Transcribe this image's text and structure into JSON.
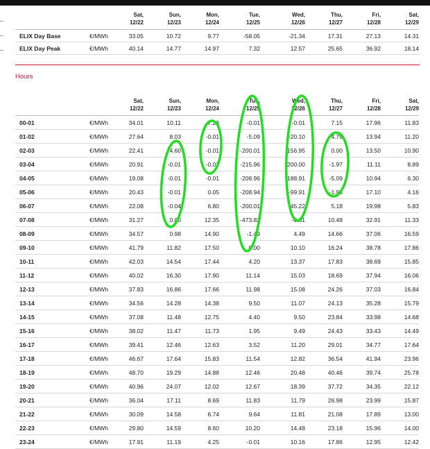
{
  "summary": {
    "days": [
      {
        "dow": "Sat,",
        "date": "12/22"
      },
      {
        "dow": "Sun,",
        "date": "12/23"
      },
      {
        "dow": "Mon,",
        "date": "12/24"
      },
      {
        "dow": "Tue,",
        "date": "12/25"
      },
      {
        "dow": "Wed,",
        "date": "12/26"
      },
      {
        "dow": "Thu,",
        "date": "12/27"
      },
      {
        "dow": "Fri,",
        "date": "12/28"
      },
      {
        "dow": "Sat,",
        "date": "12/29"
      }
    ],
    "rows": [
      {
        "label": "ELIX Day Base",
        "unit": "€/MWh",
        "values": [
          "33.05",
          "10.72",
          "9.77",
          "-58.05",
          "-21.34",
          "17.31",
          "27.13",
          "14.31"
        ]
      },
      {
        "label": "ELIX Day Peak",
        "unit": "€/MWh",
        "values": [
          "40.14",
          "14.77",
          "14.97",
          "7.32",
          "12.57",
          "25.65",
          "36.92",
          "18.14"
        ]
      }
    ]
  },
  "hours_heading": "Hours",
  "hours": {
    "days": [
      {
        "dow": "Sat,",
        "date": "12/22"
      },
      {
        "dow": "Sun,",
        "date": "12/23"
      },
      {
        "dow": "Mon,",
        "date": "12/24"
      },
      {
        "dow": "Tue,",
        "date": "12/25"
      },
      {
        "dow": "Wed,",
        "date": "12/26"
      },
      {
        "dow": "Thu,",
        "date": "12/27"
      },
      {
        "dow": "Fri,",
        "date": "12/28"
      },
      {
        "dow": "Sat,",
        "date": "12/29"
      }
    ],
    "rows": [
      {
        "label": "00-01",
        "unit": "€/MWh",
        "values": [
          "34.01",
          "10.11",
          "7.23",
          "-0.01",
          "-0.01",
          "7.15",
          "17.96",
          "11.83"
        ]
      },
      {
        "label": "01-02",
        "unit": "€/MWh",
        "values": [
          "27.64",
          "8.03",
          "-0.01",
          "-5.09",
          "-20.10",
          "4.79",
          "13.94",
          "11.20"
        ]
      },
      {
        "label": "02-03",
        "unit": "€/MWh",
        "values": [
          "22.41",
          "4.60",
          "-0.01",
          "-200.01",
          "-156.95",
          "0.00",
          "13.50",
          "10.90"
        ]
      },
      {
        "label": "03-04",
        "unit": "€/MWh",
        "values": [
          "20.91",
          "-0.01",
          "-0.07",
          "-215.96",
          "-200.00",
          "-1.97",
          "11.11",
          "8.89"
        ]
      },
      {
        "label": "04-05",
        "unit": "€/MWh",
        "values": [
          "19.08",
          "-0.01",
          "-0.01",
          "-208.96",
          "-188.91",
          "-5.09",
          "10.94",
          "6.30"
        ]
      },
      {
        "label": "05-06",
        "unit": "€/MWh",
        "values": [
          "20.43",
          "-0.01",
          "0.05",
          "-208.94",
          "-99.91",
          "-1.95",
          "17.10",
          "4.16"
        ]
      },
      {
        "label": "06-07",
        "unit": "€/MWh",
        "values": [
          "22.08",
          "-0.04",
          "6.80",
          "-200.01",
          "-45.22",
          "5.18",
          "19.98",
          "5.83"
        ]
      },
      {
        "label": "07-08",
        "unit": "€/MWh",
        "values": [
          "31.27",
          "0.00",
          "12.35",
          "-473.82",
          "-0.01",
          "10.48",
          "32.91",
          "11.33"
        ]
      },
      {
        "label": "08-09",
        "unit": "€/MWh",
        "values": [
          "34.57",
          "0.98",
          "14.90",
          "-1.49",
          "4.49",
          "14.66",
          "37.06",
          "16.59"
        ]
      },
      {
        "label": "09-10",
        "unit": "€/MWh",
        "values": [
          "41.79",
          "11.82",
          "17.50",
          "0.00",
          "10.10",
          "16.24",
          "38.78",
          "17.86"
        ]
      },
      {
        "label": "10-11",
        "unit": "€/MWh",
        "values": [
          "42.03",
          "14.54",
          "17.44",
          "4.20",
          "13.37",
          "17.83",
          "38.69",
          "15.85"
        ]
      },
      {
        "label": "11-12",
        "unit": "€/MWh",
        "values": [
          "40.02",
          "16.30",
          "17.90",
          "11.14",
          "15.03",
          "18.69",
          "37.94",
          "16.06"
        ]
      },
      {
        "label": "12-13",
        "unit": "€/MWh",
        "values": [
          "37.83",
          "16.86",
          "17.66",
          "11.98",
          "15.08",
          "24.26",
          "37.03",
          "16.84"
        ]
      },
      {
        "label": "13-14",
        "unit": "€/MWh",
        "values": [
          "34.56",
          "14.28",
          "14.38",
          "9.50",
          "11.07",
          "24.13",
          "35.28",
          "15.79"
        ]
      },
      {
        "label": "14-15",
        "unit": "€/MWh",
        "values": [
          "37.08",
          "11.48",
          "12.75",
          "4.40",
          "9.50",
          "23.84",
          "33.98",
          "14.68"
        ]
      },
      {
        "label": "15-16",
        "unit": "€/MWh",
        "values": [
          "38.02",
          "11.47",
          "11.73",
          "1.95",
          "9.49",
          "24.43",
          "33.43",
          "14.49"
        ]
      },
      {
        "label": "16-17",
        "unit": "€/MWh",
        "values": [
          "39.41",
          "12.46",
          "12.63",
          "3.52",
          "11.20",
          "29.01",
          "34.77",
          "17.64"
        ]
      },
      {
        "label": "17-18",
        "unit": "€/MWh",
        "values": [
          "46.67",
          "17.64",
          "15.83",
          "11.54",
          "12.82",
          "36.54",
          "41.94",
          "23.96"
        ]
      },
      {
        "label": "18-19",
        "unit": "€/MWh",
        "values": [
          "48.70",
          "19.29",
          "14.88",
          "12.46",
          "20.48",
          "40.46",
          "39.74",
          "25.78"
        ]
      },
      {
        "label": "19-20",
        "unit": "€/MWh",
        "values": [
          "40.96",
          "24.07",
          "12.02",
          "12.67",
          "18.39",
          "37.72",
          "34.35",
          "22.12"
        ]
      },
      {
        "label": "20-21",
        "unit": "€/MWh",
        "values": [
          "36.04",
          "17.11",
          "8.69",
          "11.83",
          "11.79",
          "26.98",
          "23.99",
          "15.87"
        ]
      },
      {
        "label": "21-22",
        "unit": "€/MWh",
        "values": [
          "30.09",
          "14.58",
          "6.74",
          "9.64",
          "11.81",
          "21.08",
          "17.89",
          "13.00"
        ]
      },
      {
        "label": "22-23",
        "unit": "€/MWh",
        "values": [
          "29.80",
          "14.59",
          "8.60",
          "10.20",
          "14.48",
          "23.18",
          "15.96",
          "14.00"
        ]
      },
      {
        "label": "23-24",
        "unit": "€/MWh",
        "values": [
          "17.91",
          "11.19",
          "4.25",
          "-0.01",
          "10.16",
          "17.86",
          "12.95",
          "12.42"
        ]
      }
    ]
  },
  "colors": {
    "accent": "#c8102e",
    "highlight": "#22dd22",
    "topbar": "#111111"
  }
}
